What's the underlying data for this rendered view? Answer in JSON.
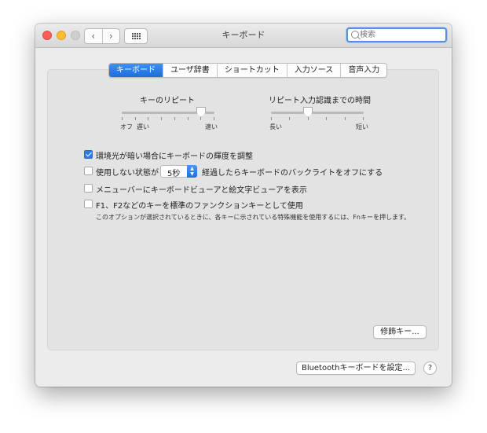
{
  "window": {
    "title": "キーボード"
  },
  "titlebar": {
    "back_glyph": "‹",
    "forward_glyph": "›",
    "search": {
      "value": "",
      "placeholder": "検索"
    }
  },
  "tabs": [
    {
      "label": "キーボード",
      "active": true
    },
    {
      "label": "ユーザ辞書",
      "active": false
    },
    {
      "label": "ショートカット",
      "active": false
    },
    {
      "label": "入力ソース",
      "active": false
    },
    {
      "label": "音声入力",
      "active": false
    }
  ],
  "key_repeat": {
    "title": "キーのリピート",
    "left_label": "オフ",
    "left_label_2": "遅い",
    "right_label": "速い",
    "tick_count": 8,
    "value_fraction": 0.86
  },
  "repeat_delay": {
    "title": "リピート入力認識までの時間",
    "left_label": "長い",
    "right_label": "短い",
    "tick_count": 6,
    "value_fraction": 0.4
  },
  "options": {
    "adjust_brightness": {
      "label": "環境光が暗い場合にキーボードの輝度を調整",
      "checked": true
    },
    "backlight_off": {
      "label_before": "使用しない状態が",
      "label_after": "経過したらキーボードのバックライトをオフにする",
      "checked": false,
      "duration_value": "5秒"
    },
    "show_viewers": {
      "label": "メニューバーにキーボードビューアと絵文字ビューアを表示",
      "checked": false
    },
    "fn_keys": {
      "label": "F1、F2などのキーを標準のファンクションキーとして使用",
      "checked": false,
      "note": "このオプションが選択されているときに、各キーに示されている特殊機能を使用するには、Fnキーを押します。"
    }
  },
  "buttons": {
    "modifier_keys": "修飾キー...",
    "bluetooth": "Bluetoothキーボードを設定...",
    "help": "?"
  },
  "colors": {
    "accent": "#2f7ae5",
    "close": "#fc5f57",
    "minimize": "#fdbb2f",
    "zoom_disabled": "#cfcfcf"
  }
}
